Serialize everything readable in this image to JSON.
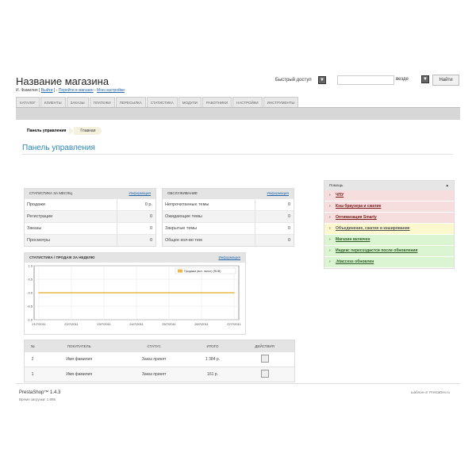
{
  "header": {
    "shop_name": "Название магазина",
    "user_name": "И. Фамилия",
    "logout": "Выйти",
    "goto_shop": "Перейти в магазин",
    "my_settings": "Мои настройки",
    "quick_access": "Быстрый доступ",
    "search_where": "везде",
    "search_button": "Найти",
    "search_value": ""
  },
  "tabs": [
    "Каталог",
    "Клиенты",
    "Заказы",
    "Платежи",
    "Пересылка",
    "Статистика",
    "Модули",
    "Работники",
    "Настройки",
    "Инструменты"
  ],
  "breadcrumb": {
    "root": "Панель управления",
    "current": "Главная"
  },
  "page": {
    "title": "Панель управления"
  },
  "stats_month": {
    "title": "Статистика за месяц",
    "more": "Информация",
    "rows": [
      {
        "label": "Продажи",
        "value": "0 р."
      },
      {
        "label": "Регистрации",
        "value": "0"
      },
      {
        "label": "Заказы",
        "value": "0"
      },
      {
        "label": "Просмотры",
        "value": "0"
      }
    ]
  },
  "service": {
    "title": "Обслуживание",
    "more": "Информация",
    "rows": [
      {
        "label": "Непрочитанные темы",
        "value": "0"
      },
      {
        "label": "Ожидающие темы",
        "value": "0"
      },
      {
        "label": "Закрытые темы",
        "value": "0"
      },
      {
        "label": "Общее кол-во тем",
        "value": "0"
      }
    ]
  },
  "help": {
    "title": "Помощь",
    "items": [
      {
        "label": "ЧПУ",
        "status": "red"
      },
      {
        "label": "Кэш браузера и сжатие",
        "status": "red"
      },
      {
        "label": "Оптимизация Smarty",
        "status": "red"
      },
      {
        "label": "Объединение, сжатие и кэширование",
        "status": "yellow"
      },
      {
        "label": "Магазин включен",
        "status": "green"
      },
      {
        "label": "Индекс пересоздастся после обновления",
        "status": "green"
      },
      {
        "label": ".htaccess обновлен",
        "status": "green"
      }
    ]
  },
  "weekly": {
    "title": "Статистика / продаж за неделю",
    "more": "Информация",
    "legend": "Продажи (вкл. налог) (RUB)"
  },
  "chart_data": {
    "type": "line",
    "x": [
      "21/7/2011",
      "22/7/2011",
      "23/7/2011",
      "24/7/2011",
      "25/7/2011",
      "26/7/2011",
      "27/7/2011"
    ],
    "series": [
      {
        "name": "Продажи (вкл. налог) (RUB)",
        "values": [
          0,
          0,
          0,
          0,
          0,
          0,
          0
        ]
      }
    ],
    "yticks": [
      "1.0",
      "0.5",
      "0.0",
      "-0.5",
      "-1.0"
    ],
    "ylim": [
      -1,
      1
    ],
    "grid": true,
    "legend_position": "top-right",
    "color": "#e8b84a"
  },
  "orders": {
    "columns": [
      "№",
      "Покупатель",
      "Статус",
      "Итого",
      "Действия"
    ],
    "rows": [
      {
        "id": "2",
        "customer": "Имя фамилия",
        "status": "Заказ принят",
        "total": "1 384 р."
      },
      {
        "id": "1",
        "customer": "Имя фамилия",
        "status": "Заказ принят",
        "total": "161 р."
      }
    ]
  },
  "footer": {
    "version": "PrestaShop™ 1.4.3",
    "load_time": "Время загрузки: 1.895",
    "credits": "шаблон от PrestaDev.ru"
  }
}
